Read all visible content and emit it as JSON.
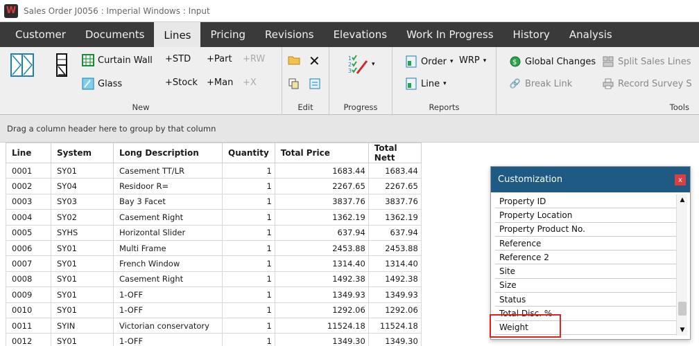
{
  "window": {
    "title": "Sales Order J0056   : Imperial Windows : Input"
  },
  "menu": [
    {
      "label": "Customer"
    },
    {
      "label": "Documents"
    },
    {
      "label": "Lines",
      "active": true
    },
    {
      "label": "Pricing"
    },
    {
      "label": "Revisions"
    },
    {
      "label": "Elevations"
    },
    {
      "label": "Work In Progress"
    },
    {
      "label": "History"
    },
    {
      "label": "Analysis"
    }
  ],
  "ribbon": {
    "new": {
      "label": "New",
      "curtain_wall": "Curtain Wall",
      "glass": "Glass",
      "std": "+STD",
      "stock": "+Stock",
      "part": "+Part",
      "man": "+Man",
      "rw": "+RW",
      "x": "+X"
    },
    "edit": {
      "label": "Edit"
    },
    "progress": {
      "label": "Progress"
    },
    "reports": {
      "label": "Reports",
      "order": "Order",
      "line": "Line",
      "wrp": "WRP"
    },
    "tools": {
      "label": "Tools",
      "global_changes": "Global Changes",
      "split_sales_lines": "Split Sales Lines",
      "break_link": "Break Link",
      "record_survey": "Record Survey S"
    }
  },
  "grid": {
    "group_hint": "Drag a column header here to group by that column",
    "columns": [
      "Line",
      "System",
      "Long Description",
      "Quantity",
      "Total Price",
      "Total Nett"
    ],
    "rows": [
      [
        "0001",
        "SY01",
        "Casement TT/LR",
        "1",
        "1683.44",
        "1683.44"
      ],
      [
        "0002",
        "SY04",
        "Residoor R=",
        "1",
        "2267.65",
        "2267.65"
      ],
      [
        "0003",
        "SY03",
        "Bay 3 Facet",
        "1",
        "3837.76",
        "3837.76"
      ],
      [
        "0004",
        "SY02",
        "Casement Right",
        "1",
        "1362.19",
        "1362.19"
      ],
      [
        "0005",
        "SYHS",
        "Horizontal Slider",
        "1",
        "637.94",
        "637.94"
      ],
      [
        "0006",
        "SY01",
        "Multi Frame",
        "1",
        "2453.88",
        "2453.88"
      ],
      [
        "0007",
        "SY01",
        "French Window",
        "1",
        "1314.40",
        "1314.40"
      ],
      [
        "0008",
        "SY01",
        "Casement Right",
        "1",
        "1492.38",
        "1492.38"
      ],
      [
        "0009",
        "SY01",
        "1-OFF",
        "1",
        "1349.93",
        "1349.93"
      ],
      [
        "0010",
        "SY01",
        "1-OFF",
        "1",
        "1292.06",
        "1292.06"
      ],
      [
        "0011",
        "SYIN",
        "Victorian conservatory",
        "1",
        "11524.18",
        "11524.18"
      ],
      [
        "0012",
        "SY01",
        "1-OFF",
        "1",
        "1349.30",
        "1349.30"
      ]
    ]
  },
  "customization": {
    "title": "Customization",
    "close": "x",
    "items": [
      "Property ID",
      "Property Location",
      "Property Product No.",
      "Reference",
      "Reference 2",
      "Site",
      "Size",
      "Status",
      "Total Disc. %",
      "Weight"
    ],
    "highlighted_item": "Weight",
    "highlight_color": "#e0201b"
  },
  "colors": {
    "menubar": "#3a3a3a",
    "panel_header": "#1f5a85",
    "close_button": "#d94040"
  }
}
